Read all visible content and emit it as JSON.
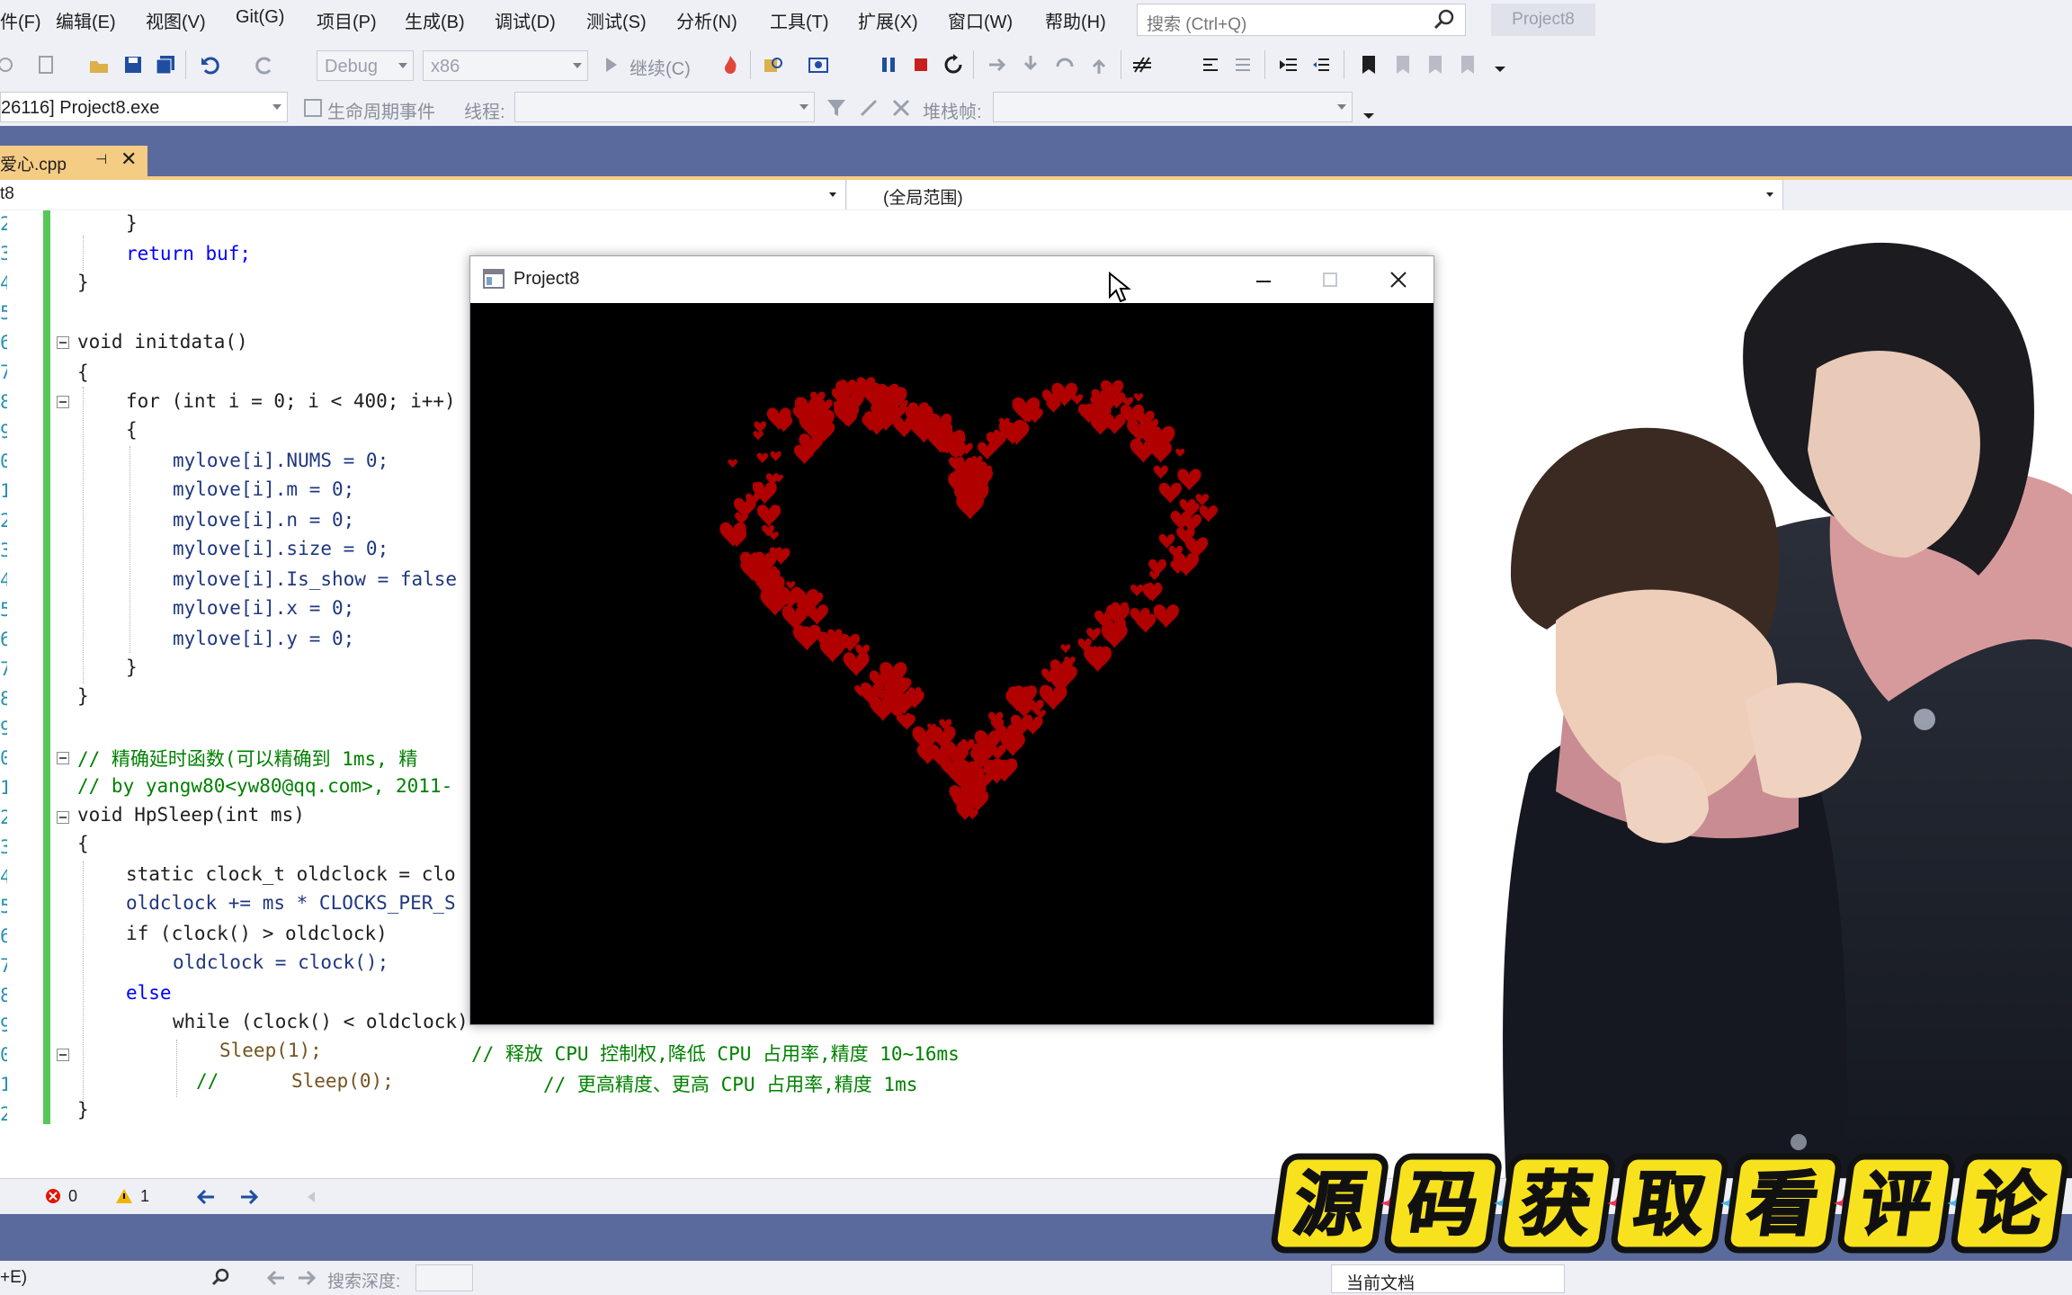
{
  "menu": {
    "items": [
      "件(F)",
      "编辑(E)",
      "视图(V)",
      "Git(G)",
      "项目(P)",
      "生成(B)",
      "调试(D)",
      "测试(S)",
      "分析(N)",
      "工具(T)",
      "扩展(X)",
      "窗口(W)",
      "帮助(H)"
    ],
    "search_placeholder": "搜索 (Ctrl+Q)",
    "project_badge": "Project8"
  },
  "toolbar": {
    "config": "Debug",
    "platform": "x86",
    "continue_label": "继续(C)"
  },
  "toolbar2": {
    "process": "26116] Project8.exe",
    "lifecycle_label": "生命周期事件",
    "thread_label": "线程:",
    "stackframe_label": "堆栈帧:"
  },
  "tab": {
    "filename": "爱心.cpp"
  },
  "navbar": {
    "left": "t8",
    "right": "(全局范围)"
  },
  "code": {
    "line_numbers": [
      "2",
      "3",
      "4",
      "5",
      "6",
      "7",
      "8",
      "9",
      "0",
      "1",
      "2",
      "3",
      "4",
      "5",
      "6",
      "7",
      "8",
      "9",
      "0",
      "1",
      "2",
      "3",
      "4",
      "5",
      "6",
      "7",
      "8",
      "9",
      "0",
      "1",
      "2"
    ],
    "lines": [
      "}",
      "return buf;",
      "}",
      "",
      "void initdata()",
      "{",
      "for (int i = 0; i < 400; i++)",
      "{",
      "mylove[i].NUMS = 0;",
      "mylove[i].m = 0;",
      "mylove[i].n = 0;",
      "mylove[i].size = 0;",
      "mylove[i].Is_show = false",
      "mylove[i].x = 0;",
      "mylove[i].y = 0;",
      "}",
      "}",
      "",
      "// 精确延时函数(可以精确到 1ms, 精",
      "// by yangw80<yw80@qq.com>, 2011-",
      "void HpSleep(int ms)",
      "{",
      "static clock_t oldclock = clo",
      "oldclock += ms * CLOCKS_PER_S",
      "if (clock() > oldclock)",
      "oldclock = clock();",
      "else",
      "while (clock() < oldclock)",
      "Sleep(1);",
      "// 释放 CPU 控制权,降低 CPU 占用率,精度 10~16ms",
      "//",
      "Sleep(0);",
      "// 更高精度、更高 CPU 占用率,精度 1ms",
      "}"
    ]
  },
  "app_window": {
    "title": "Project8"
  },
  "status": {
    "errors": "0",
    "warnings": "1",
    "search_depth_label": "搜索深度:",
    "search_shortcut": "+E)",
    "current_doc": "当前文档"
  },
  "banner": {
    "text": [
      "源",
      "码",
      "获",
      "取",
      "看",
      "评",
      "论"
    ]
  },
  "colors": {
    "accent_tab": "#f5cc84",
    "tabwell": "#5b6a9d",
    "change_bar": "#57c757",
    "heart": "#b00000"
  }
}
